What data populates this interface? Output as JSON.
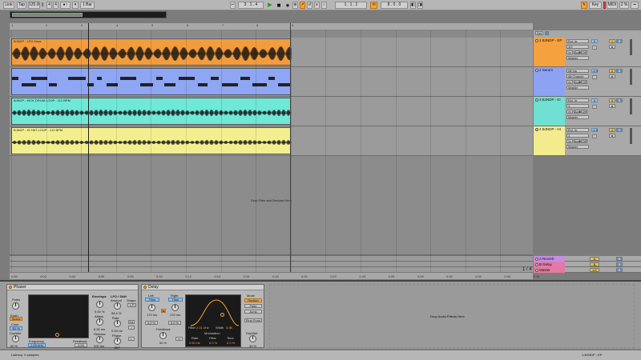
{
  "topbar": {
    "link": "Link",
    "tap": "Tap",
    "tempo": "125.00",
    "sig_num": "4",
    "sig_den": "4",
    "metro": "●○",
    "quant": "1 Bar",
    "pos": "3 . 1 . 4",
    "loop_start": "1 . 1 . 1",
    "loop_len": "8 . 0 . 0",
    "key": "Key",
    "midi": "MIDI",
    "cpu": "2 %"
  },
  "ruler": [
    "1",
    "2",
    "3",
    "4",
    "5",
    "6",
    "7",
    "8",
    "9"
  ],
  "tracks": [
    {
      "clip": "BJNDP - LFO Keys",
      "name": "1 BJNDP - EP",
      "input": "Ext. In",
      "chan": "1/2",
      "mon": "In",
      "out": "Master",
      "vol": "0",
      "num": "1",
      "color": "#f4a13e",
      "clipColor": "#f39c3c"
    },
    {
      "clip": "",
      "name": "2 Serum",
      "input": "All Ins",
      "chan": "All Channe",
      "mon": "In",
      "out": "Master",
      "vol": "-4.5",
      "num": "2",
      "color": "#8da2f3",
      "clipColor": "#8ea6f3"
    },
    {
      "clip": "BJNDP - KICK DRUM LOOP - 112 BPM",
      "name": "3 BJNDP - KI",
      "input": "Ext. In",
      "chan": "1",
      "mon": "In",
      "out": "Master",
      "vol": "0",
      "num": "3",
      "color": "#6fe0d2",
      "clipColor": "#6fe8d8"
    },
    {
      "clip": "BJNDP - HI HAT LOOP - 112 BPM",
      "name": "4 BJNDP - HI",
      "input": "Ext. In",
      "chan": "1",
      "mon": "In",
      "out": "Master",
      "vol": "-4.8",
      "num": "4",
      "color": "#f2ec8e",
      "clipColor": "#f3ef8f"
    }
  ],
  "drop_files": "Drop Files and Devices Here",
  "returns": [
    {
      "name": "A Reverb",
      "send": "A",
      "color": "#c48fe0"
    },
    {
      "name": "B Delay",
      "send": "B",
      "color": "#e07ab0"
    },
    {
      "name": "Master",
      "send": "1/2",
      "color": "#e57a9a"
    }
  ],
  "zoom": "1 / 4",
  "time_ruler": [
    "0:00",
    "0:02",
    "0:04",
    "0:06",
    "0:08",
    "0:10",
    "0:12",
    "0:14",
    "0:16",
    "0:18",
    "0:20",
    "0:22",
    "0:24",
    "0:26",
    "0:28",
    "0:30",
    "0:32",
    "0:34",
    "0:36"
  ],
  "phaser": {
    "title": "Phaser",
    "poles": "Poles",
    "poles_val": "4",
    "earth": "Earth",
    "space": "Space",
    "color": "Color",
    "color_val": "50 %",
    "drywet": "Dry/Wet",
    "drywet_val": "50 %",
    "frequency": "Frequency",
    "freq_val": "1.00 kHz",
    "feedback": "Feedback",
    "feedback_val": "0.00",
    "envelope": "Envelope",
    "env_val": "0.00 %",
    "attack": "Attack",
    "attack_val": "6.00 ms",
    "release": "Release",
    "release_val": "200 ms",
    "lfo": "LFO / S&H",
    "amount": "Amount",
    "shape": "Shape",
    "amount_val": "98.4 %",
    "rate": "Rate",
    "rate_val": "0.53 Hz",
    "phase": "Phase",
    "phase_val": "180°"
  },
  "delay": {
    "title": "Delay",
    "left": "Left",
    "right": "Right",
    "time": "Time",
    "left_val": "170 ms",
    "right_val": "170 ms",
    "left_off": "0.0 %",
    "right_off": "0.0 %",
    "feedback": "Feedback",
    "feedback_val": "50 %",
    "filter": "Filter",
    "filter_val": "2.41 kHz",
    "width": "Width",
    "width_val": "3.98",
    "modulation": "Modulation",
    "mod_rate": "Rate",
    "mod_rate_val": "0.50 Hz",
    "mod_filter": "Filter",
    "mod_filter_val": "0.0 %",
    "mod_time": "Time",
    "mod_time_val": "0.0 %",
    "mode": "Mode",
    "repitch": "Repitch",
    "fade": "Fade",
    "jump": "Jump",
    "pingpong": "Ping Pong",
    "drywet": "Dry/Wet",
    "drywet_val": "30 %"
  },
  "drop_effects": "Drop Audio Effects Here",
  "status_left": "Latency: 0 samples",
  "status_right": "1-BJNDP - EP"
}
